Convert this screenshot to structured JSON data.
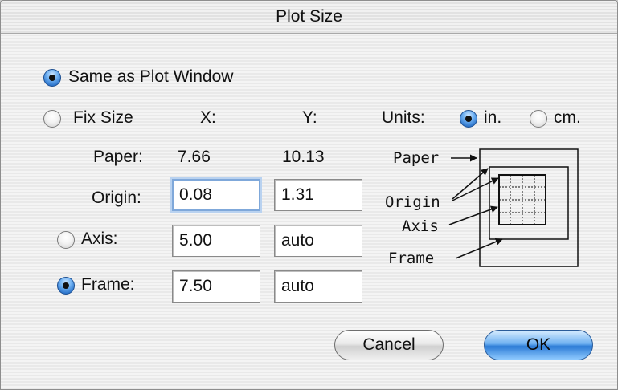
{
  "window": {
    "title": "Plot Size"
  },
  "options": {
    "same_as_plot_window": {
      "label": "Same as Plot Window",
      "selected": true
    },
    "fix_size": {
      "label": "Fix Size",
      "selected": false
    }
  },
  "columns": {
    "x": "X:",
    "y": "Y:"
  },
  "units": {
    "label": "Units:",
    "inches": {
      "label": "in.",
      "selected": true
    },
    "cm": {
      "label": "cm.",
      "selected": false
    }
  },
  "paper": {
    "label": "Paper:",
    "x": "7.66",
    "y": "10.13"
  },
  "origin": {
    "label": "Origin:",
    "x": "0.08",
    "y": "1.31"
  },
  "axis": {
    "label": "Axis:",
    "selected": false,
    "x": "5.00",
    "y": "auto"
  },
  "frame": {
    "label": "Frame:",
    "selected": true,
    "x": "7.50",
    "y": "auto"
  },
  "diagram": {
    "paper": "Paper",
    "origin": "Origin",
    "axis": "Axis",
    "frame": "Frame"
  },
  "buttons": {
    "cancel": "Cancel",
    "ok": "OK"
  }
}
